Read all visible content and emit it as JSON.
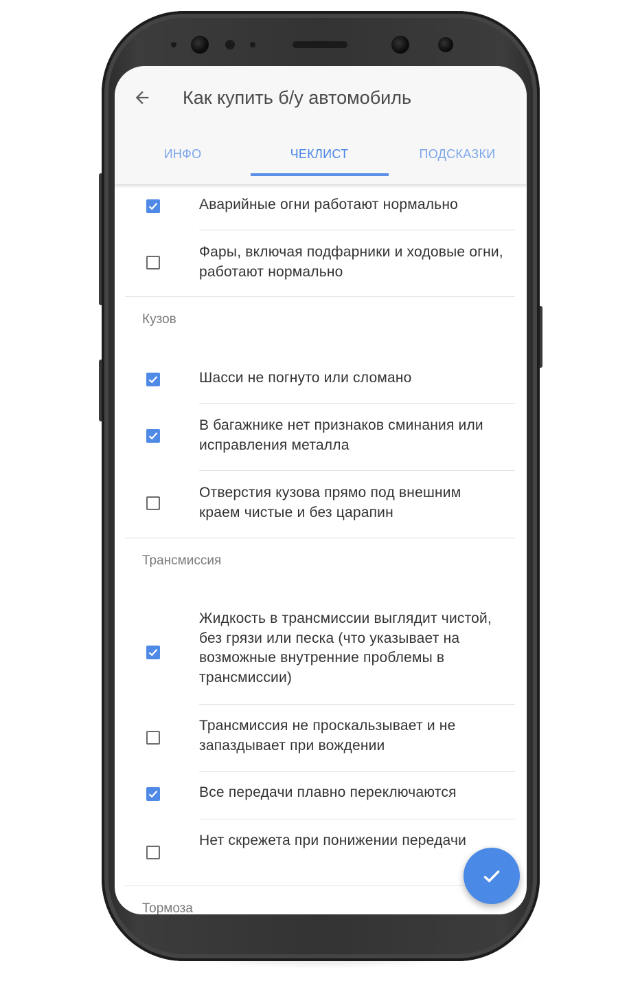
{
  "app": {
    "title": "Как купить б/у автомобиль"
  },
  "tabs": [
    {
      "label": "ИНФО",
      "active": false
    },
    {
      "label": "ЧЕКЛИСТ",
      "active": true
    },
    {
      "label": "ПОДСКАЗКИ",
      "active": false
    }
  ],
  "sections": [
    {
      "label": ""
    },
    {
      "label": "Кузов"
    },
    {
      "label": "Трансмиссия"
    },
    {
      "label": "Тормоза"
    }
  ],
  "items": [
    {
      "text": "Аварийные огни работают нормально",
      "checked": true
    },
    {
      "text": "Фары, включая подфарники и ходовые огни, работают нормально",
      "checked": false
    },
    {
      "text": "Шасси не погнуто или сломано",
      "checked": true
    },
    {
      "text": "В багажнике нет признаков сминания или исправления металла",
      "checked": true
    },
    {
      "text": "Отверстия кузова прямо под внешним краем чистые и без царапин",
      "checked": false
    },
    {
      "text": "Жидкость в трансмиссии выглядит чистой, без грязи или песка (что указывает на возможные внутренние проблемы в трансмиссии)",
      "checked": true
    },
    {
      "text": "Трансмиссия не проскальзывает и не запаздывает при вождении",
      "checked": false
    },
    {
      "text": "Все передачи плавно переключаются",
      "checked": true
    },
    {
      "text": "Нет скрежета при понижении передачи",
      "checked": false
    }
  ],
  "icons": {
    "back": "arrow-back-icon",
    "check": "checkmark-icon",
    "fab": "done-icon"
  },
  "colors": {
    "accent": "#4a86e8",
    "tab_inactive": "#7ba6ea",
    "checkbox_checked": "#4f8ae6",
    "fab": "#4a8ae6"
  }
}
